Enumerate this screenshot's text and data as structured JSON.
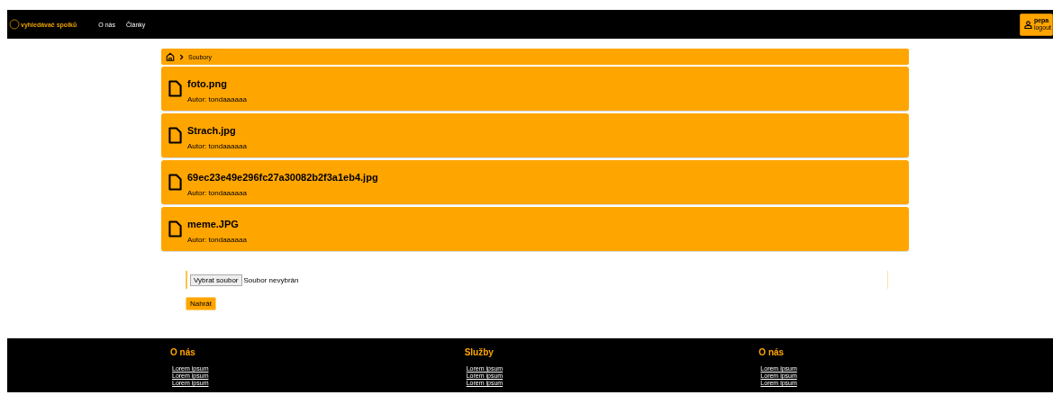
{
  "navbar": {
    "logo": "vyhledávač spolků",
    "links": [
      "O nás",
      "Články"
    ],
    "user": {
      "name": "pepa",
      "logout": "logout"
    }
  },
  "breadcrumb": {
    "items": [
      "Soubory"
    ]
  },
  "files": [
    {
      "name": "foto.png",
      "author": "Autor: tondaaaaaa"
    },
    {
      "name": "Strach.jpg",
      "author": "Autor: tondaaaaaa"
    },
    {
      "name": "69ec23e49e296fc27a30082b2f3a1eb4.jpg",
      "author": "Autor: tondaaaaaa"
    },
    {
      "name": "meme.JPG",
      "author": "Autor: tondaaaaaa"
    }
  ],
  "upload": {
    "choose_button": "Vybrat soubor",
    "status": "Soubor nevybrán",
    "submit": "Nahrát"
  },
  "footer": {
    "columns": [
      {
        "title": "O nás",
        "links": [
          "Lorem ipsum",
          "Lorem ipsum",
          "Lorem ipsum"
        ]
      },
      {
        "title": "Služby",
        "links": [
          "Lorem ipsum",
          "Lorem ipsum",
          "Lorem ipsum"
        ]
      },
      {
        "title": "O nás",
        "links": [
          "Lorem ipsum",
          "Lorem ipsum",
          "Lorem ipsum"
        ]
      }
    ]
  }
}
